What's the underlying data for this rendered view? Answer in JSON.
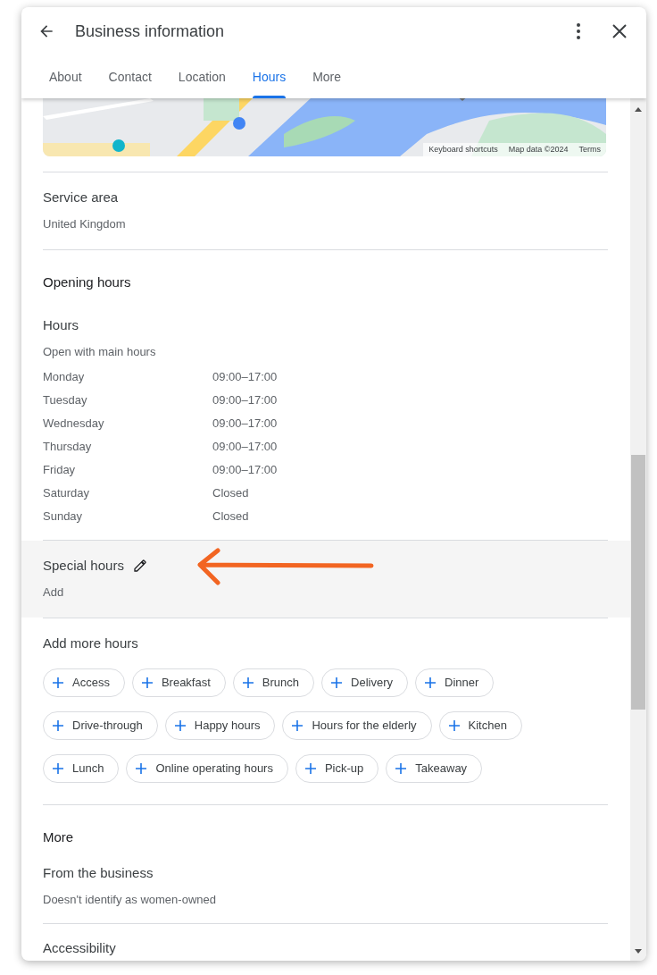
{
  "dialog": {
    "title": "Business information"
  },
  "tabs": [
    {
      "label": "About",
      "selected": false
    },
    {
      "label": "Contact",
      "selected": false
    },
    {
      "label": "Location",
      "selected": false
    },
    {
      "label": "Hours",
      "selected": true
    },
    {
      "label": "More",
      "selected": false
    }
  ],
  "map": {
    "attribution": [
      "Keyboard shortcuts",
      "Map data ©2024",
      "Terms"
    ]
  },
  "service_area": {
    "title": "Service area",
    "value": "United Kingdom"
  },
  "opening_hours": {
    "heading": "Opening hours",
    "title": "Hours",
    "subtitle": "Open with main hours",
    "days": [
      {
        "day": "Monday",
        "hours": "09:00–17:00"
      },
      {
        "day": "Tuesday",
        "hours": "09:00–17:00"
      },
      {
        "day": "Wednesday",
        "hours": "09:00–17:00"
      },
      {
        "day": "Thursday",
        "hours": "09:00–17:00"
      },
      {
        "day": "Friday",
        "hours": "09:00–17:00"
      },
      {
        "day": "Saturday",
        "hours": "Closed"
      },
      {
        "day": "Sunday",
        "hours": "Closed"
      }
    ]
  },
  "special_hours": {
    "title": "Special hours",
    "value": "Add"
  },
  "add_more_hours": {
    "title": "Add more hours",
    "chips": [
      [
        "Access",
        "Breakfast",
        "Brunch",
        "Delivery",
        "Dinner"
      ],
      [
        "Drive-through",
        "Happy hours",
        "Hours for the elderly",
        "Kitchen"
      ],
      [
        "Lunch",
        "Online operating hours",
        "Pick-up",
        "Takeaway"
      ]
    ]
  },
  "more": {
    "heading": "More",
    "title": "From the business",
    "value": "Doesn't identify as women-owned",
    "next_title": "Accessibility"
  }
}
